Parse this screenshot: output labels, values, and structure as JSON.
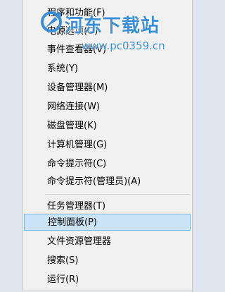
{
  "menu": {
    "items": [
      {
        "label": "程序和功能(F)"
      },
      {
        "label": "电源选项(O)"
      },
      {
        "label": "事件查看器(V)"
      },
      {
        "label": "系统(Y)"
      },
      {
        "label": "设备管理器(M)"
      },
      {
        "label": "网络连接(W)"
      },
      {
        "label": "磁盘管理(K)"
      },
      {
        "label": "计算机管理(G)"
      },
      {
        "label": "命令提示符(C)"
      },
      {
        "label": "命令提示符(管理员)(A)"
      },
      {
        "label": "任务管理器(T)"
      },
      {
        "label": "控制面板(P)"
      },
      {
        "label": "文件资源管理器"
      },
      {
        "label": "搜索(S)"
      },
      {
        "label": "运行(R)"
      }
    ],
    "selected": "控制面板(P)"
  },
  "watermark": {
    "title": "河东下载站",
    "url": "www.pc0359.cn",
    "color": "#3a8fd8"
  },
  "colors": {
    "menu_bg": "#f1f1f1",
    "selection_bg": "#cce4f7",
    "selection_border": "#7fb3e0"
  }
}
